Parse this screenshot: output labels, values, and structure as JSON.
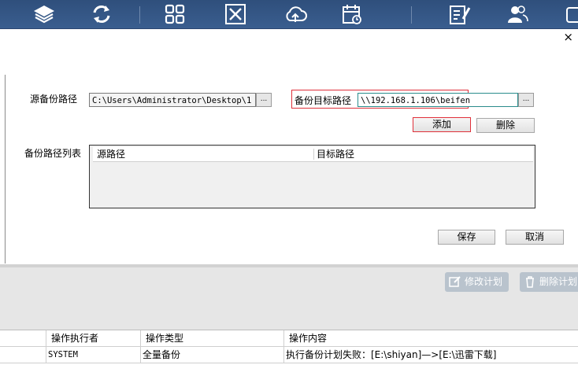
{
  "toolbar": {
    "icons": [
      "layers-icon",
      "sync-icon",
      "grid-icon",
      "tools-icon",
      "cloud-upload-icon",
      "calendar-icon",
      "edit-document-icon",
      "users-icon",
      "window-icon"
    ]
  },
  "dialog": {
    "close_symbol": "×",
    "source_label": "源备份路径",
    "source_value": "C:\\Users\\Administrator\\Desktop\\1",
    "browse_label": "...",
    "target_label": "备份目标路径",
    "target_value": "\\\\192.168.1.106\\beifen",
    "add_label": "添加",
    "delete_label": "删除",
    "list_label": "备份路径列表",
    "list_columns": [
      "源路径",
      "目标路径"
    ],
    "save_label": "保存",
    "cancel_label": "取消"
  },
  "actions": {
    "edit_plan": "修改计划",
    "delete_plan": "删除计划"
  },
  "log_table": {
    "columns": [
      "操作执行者",
      "操作类型",
      "操作内容"
    ],
    "rows": [
      [
        "SYSTEM",
        "全量备份",
        "执行备份计划失败：[E:\\shiyan]—>[E:\\迅雷下载]"
      ]
    ]
  },
  "colors": {
    "toolbar_bg": "#34578a",
    "highlight_frame": "#e0303a",
    "action_button": "#b9c3cd"
  }
}
